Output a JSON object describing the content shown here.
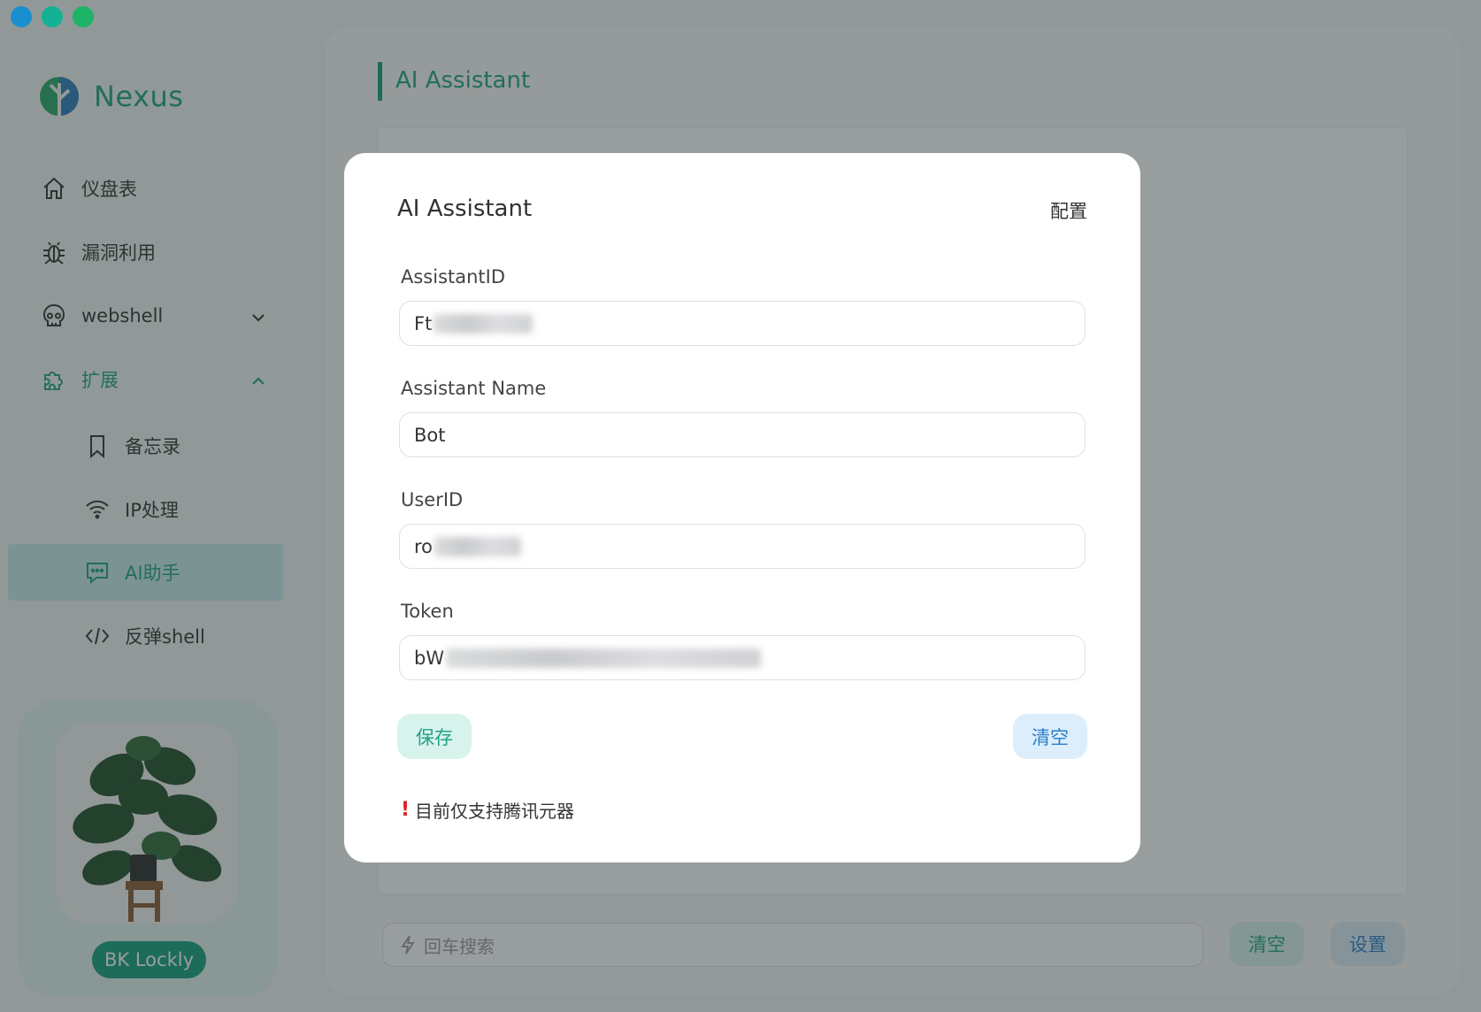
{
  "app": {
    "name": "Nexus"
  },
  "sidebar": {
    "items": [
      {
        "label": "仪盘表",
        "icon": "home-icon"
      },
      {
        "label": "漏洞利用",
        "icon": "bug-icon"
      },
      {
        "label": "webshell",
        "icon": "skull-icon",
        "expanded": false
      },
      {
        "label": "扩展",
        "icon": "puzzle-icon",
        "expanded": true
      }
    ],
    "sub_items": [
      {
        "label": "备忘录",
        "icon": "bookmark-icon"
      },
      {
        "label": "IP处理",
        "icon": "wifi-icon"
      },
      {
        "label": "AI助手",
        "icon": "chat-icon",
        "active": true
      },
      {
        "label": "反弹shell",
        "icon": "code-icon"
      }
    ],
    "user": {
      "name": "BK Lockly"
    }
  },
  "main": {
    "title": "AI Assistant",
    "search": {
      "placeholder": "回车搜索"
    },
    "clear_label": "清空",
    "settings_label": "设置"
  },
  "modal": {
    "title": "AI Assistant",
    "action_label": "配置",
    "fields": [
      {
        "label": "AssistantID",
        "value": "Ft"
      },
      {
        "label": "Assistant Name",
        "value": "Bot"
      },
      {
        "label": "UserID",
        "value": "ro"
      },
      {
        "label": "Token",
        "value": "bW"
      }
    ],
    "save_label": "保存",
    "clear_label": "清空",
    "note_mark": "!",
    "note": "目前仅支持腾讯元器"
  },
  "colors": {
    "accent": "#14a07e",
    "secondary": "#2a7fc9",
    "warning": "#e02020"
  }
}
